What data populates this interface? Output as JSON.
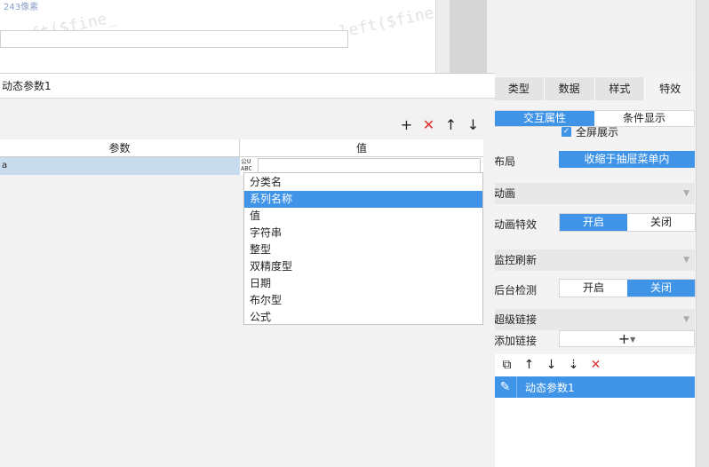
{
  "background": {
    "hint_text": "243像素",
    "watermark_text": "-left($fine_",
    "watermark_text_2": "-left($fine_c"
  },
  "right_panel": {
    "tabs": [
      "类型",
      "数据",
      "样式",
      "特效"
    ],
    "active_tab_index": 3,
    "subtabs": [
      "交互属性",
      "条件显示"
    ],
    "active_subtab_index": 0,
    "fullscreen_label": "全屏展示",
    "fullscreen_checked": true,
    "layout_label": "布局",
    "layout_value": "收缩于抽屉菜单内",
    "animation_section": "动画",
    "animation_effect_label": "动画特效",
    "animation_toggle": [
      "开启",
      "关闭"
    ],
    "animation_on_index": 0,
    "monitor_section": "监控刷新",
    "background_check_label": "后台检测",
    "monitor_toggle": [
      "开启",
      "关闭"
    ],
    "monitor_on_index": 1,
    "hyperlink_section": "超级链接",
    "add_link_label": "添加链接",
    "add_link_button": "+",
    "link_items": [
      "动态参数1"
    ]
  },
  "dialog": {
    "title": "动态参数1",
    "columns": [
      "参数",
      "值"
    ],
    "row_param_name": "a",
    "type_icon_text": "公U ABC",
    "value_input": "",
    "type_options": [
      "分类名",
      "系列名称",
      "值",
      "字符串",
      "整型",
      "双精度型",
      "日期",
      "布尔型",
      "公式"
    ],
    "selected_option_index": 1
  },
  "colors": {
    "accent": "#3f94e8",
    "delete_red": "#e03030",
    "row_highlight": "#c9dcee"
  }
}
